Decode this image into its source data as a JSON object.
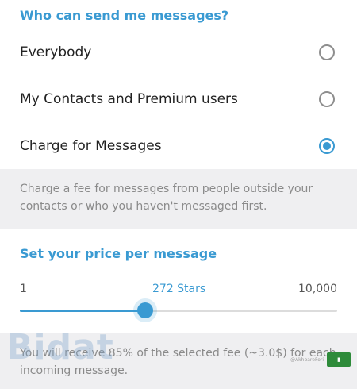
{
  "who_section": {
    "header": "Who can send me messages?",
    "options": [
      {
        "label": "Everybody",
        "selected": false
      },
      {
        "label": "My Contacts and Premium users",
        "selected": false
      },
      {
        "label": "Charge for Messages",
        "selected": true
      }
    ],
    "info": "Charge a fee for messages from people outside your contacts or who you haven't messaged first."
  },
  "price_section": {
    "header": "Set your price per message",
    "slider": {
      "min_label": "1",
      "current_label": "272 Stars",
      "max_label": "10,000",
      "fill_fraction": 0.395
    },
    "info": "You will receive 85% of the selected fee (~3.0$) for each incoming message."
  },
  "watermark": {
    "text": "Bidat",
    "credit": "@AkhbareFori"
  },
  "colors": {
    "accent": "#3a9ad2",
    "info_background": "#efeff1"
  }
}
